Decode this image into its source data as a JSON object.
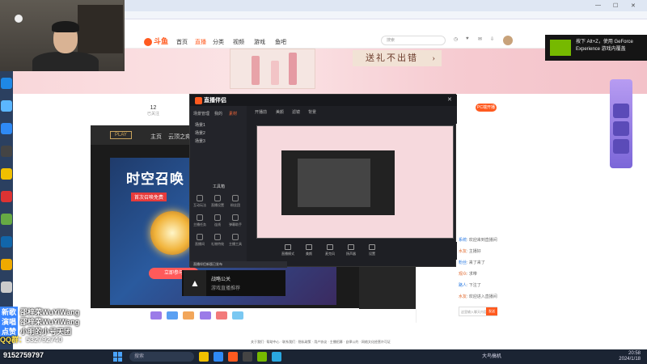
{
  "browser": {
    "site_nav": {
      "logo": "斗鱼",
      "items": [
        "首页",
        "直播",
        "分类",
        "视频",
        "游戏",
        "鱼吧"
      ],
      "active_index": 1,
      "search_placeholder": "搜索"
    },
    "promo": {
      "text": "送礼不出错",
      "arrow": "›"
    },
    "room": {
      "follow_count": "12",
      "follow_label": "已关注"
    },
    "fav_button": "PC端开播"
  },
  "nvidia_toast": {
    "line1": "按下 Alt+Z，使用 GeForce",
    "line2": "Experience 游戏内覆盖"
  },
  "player": {
    "play_pill": "PLAY",
    "tabs": [
      "主页",
      "云顶之弈"
    ],
    "game_title": "时空召唤",
    "game_tag": "首次召唤免费",
    "cta": "立即参与"
  },
  "stream_app": {
    "brand": "直播伴侣",
    "side_tabs": [
      "场景管理",
      "我的",
      "素材"
    ],
    "scenes": [
      "场景1",
      "场景2",
      "场景3"
    ],
    "tools_title": "工具箱",
    "tools": [
      "互动玩法",
      "直播设置",
      "粉丝团",
      "主播任务",
      "连线",
      "弹幕助手",
      "直播间",
      "礼物特效",
      "主播工具"
    ],
    "toolbar": [
      "开播前",
      "美颜",
      "滤镜",
      "背景"
    ],
    "controls": [
      "直播模式",
      "美颜",
      "麦克风",
      "扬声器",
      "设置"
    ],
    "notice": "直播伴侣新版已发布"
  },
  "overlay_tile": {
    "title": "战略公关",
    "subtitle": "游戏直播推荐"
  },
  "chat": {
    "messages": [
      {
        "user": "系统",
        "text": "欢迎来到直播间"
      },
      {
        "user": "水友",
        "text": "主播好"
      },
      {
        "user": "粉丝",
        "text": "来了来了"
      },
      {
        "user": "观众",
        "text": "求带"
      },
      {
        "user": "路人",
        "text": "下注了"
      },
      {
        "user": "水友",
        "text": "欢迎进入直播间"
      }
    ],
    "input_placeholder": "这里输入聊天内容",
    "send": "发送"
  },
  "footer_links": "关于我们 · 帮助中心 · 联系我们 · 隐私政策 · 用户协议 · 主播招募 · 自律公约 · 网络文化经营许可证",
  "stream_overlay": {
    "rows": [
      {
        "tag": "新歌",
        "value": "邵梓荣WuYiWang"
      },
      {
        "tag": "演唱",
        "value": "邵梓荣WuYiWang"
      },
      {
        "tag": "点赞",
        "value": "小明的小号天团"
      }
    ],
    "qq_label": "QQ群：",
    "qq_value": "532792740",
    "bottom_value": "9152759797"
  },
  "taskbar": {
    "search": "搜索",
    "user": "大鸟搞机",
    "time": "20:58",
    "date": "2024/1/18"
  },
  "colors": {
    "accent": "#ff5a1f",
    "brand_blue": "#3a86ff",
    "nvidia_green": "#76b900"
  }
}
